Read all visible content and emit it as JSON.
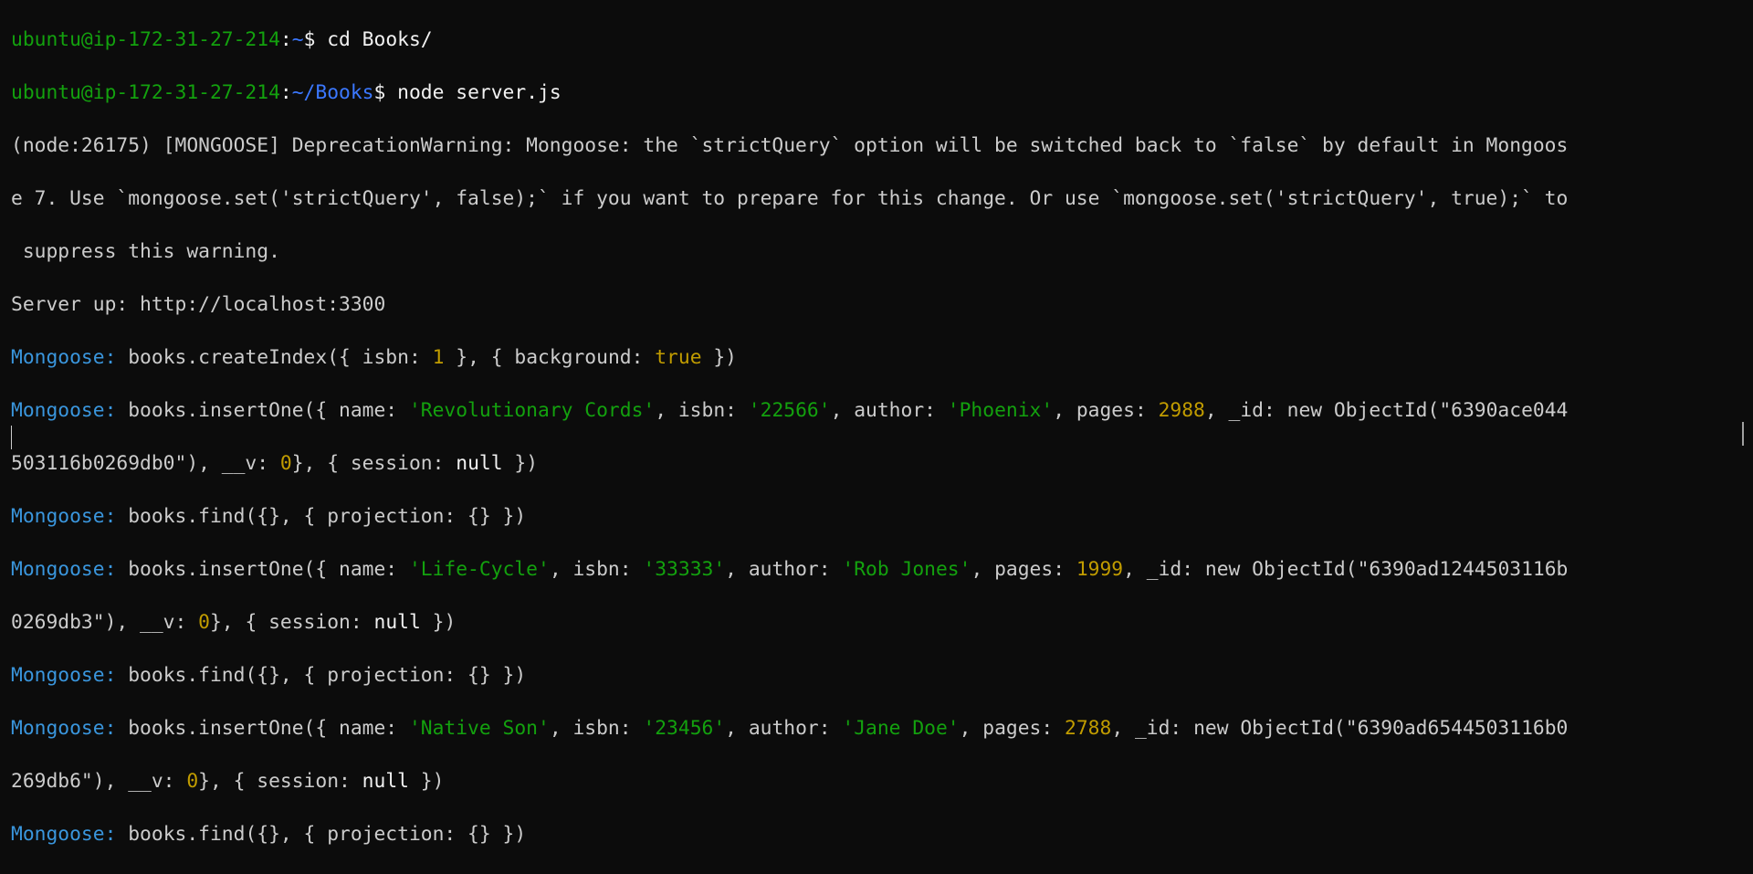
{
  "prompt": {
    "user_host": "ubuntu@ip-172-31-27-214",
    "colon": ":",
    "dollar": "$ "
  },
  "lines": {
    "l1": {
      "path": "~",
      "cmd": "cd Books/"
    },
    "l2": {
      "path": "~/Books",
      "cmd": "node server.js"
    },
    "l3": "(node:26175) [MONGOOSE] DeprecationWarning: Mongoose: the `strictQuery` option will be switched back to `false` by default in Mongoos",
    "l4": "e 7. Use `mongoose.set('strictQuery', false);` if you want to prepare for this change. Or use `mongoose.set('strictQuery', true);` to",
    "l5": " suppress this warning.",
    "l6": "Server up: http://localhost:3300",
    "mongoose_label": "Mongoose:",
    "l7": {
      "pre": " books.createIndex({ isbn: ",
      "num": "1",
      "mid": " }, { background: ",
      "bool": "true",
      "post": " })"
    },
    "l8": {
      "pre": " books.insertOne({ name: ",
      "name": "'Revolutionary Cords'",
      "isbn_k": ", isbn: ",
      "isbn": "'22566'",
      "author_k": ", author: ",
      "author": "'Phoenix'",
      "pages_k": ", pages: ",
      "pages": "2988",
      "id_k": ", _id: new ObjectId(\"6390ace044"
    },
    "l9": {
      "pre": "503116b0269db0\"), __v: ",
      "v": "0",
      "mid": "}, { session: ",
      "null": "null",
      "post": " })"
    },
    "l10": " books.find({}, { projection: {} })",
    "l11": {
      "pre": " books.insertOne({ name: ",
      "name": "'Life-Cycle'",
      "isbn_k": ", isbn: ",
      "isbn": "'33333'",
      "author_k": ", author: ",
      "author": "'Rob Jones'",
      "pages_k": ", pages: ",
      "pages": "1999",
      "id_k": ", _id: new ObjectId(\"6390ad1244503116b"
    },
    "l12": {
      "pre": "0269db3\"), __v: ",
      "v": "0",
      "mid": "}, { session: ",
      "null": "null",
      "post": " })"
    },
    "l13": " books.find({}, { projection: {} })",
    "l14": {
      "pre": " books.insertOne({ name: ",
      "name": "'Native Son'",
      "isbn_k": ", isbn: ",
      "isbn": "'23456'",
      "author_k": ", author: ",
      "author": "'Jane Doe'",
      "pages_k": ", pages: ",
      "pages": "2788",
      "id_k": ", _id: new ObjectId(\"6390ad6544503116b0"
    },
    "l15": {
      "pre": "269db6\"), __v: ",
      "v": "0",
      "mid": "}, { session: ",
      "null": "null",
      "post": " })"
    },
    "l16": " books.find({}, { projection: {} })"
  },
  "colors": {
    "background": "#0c0c0c",
    "foreground": "#cccccc",
    "prompt_green": "#13a10e",
    "path_blue": "#3b78ff",
    "mongoose_blue": "#3a96dd",
    "number_yellow": "#c19c00",
    "bright_white": "#f2f2f2"
  }
}
